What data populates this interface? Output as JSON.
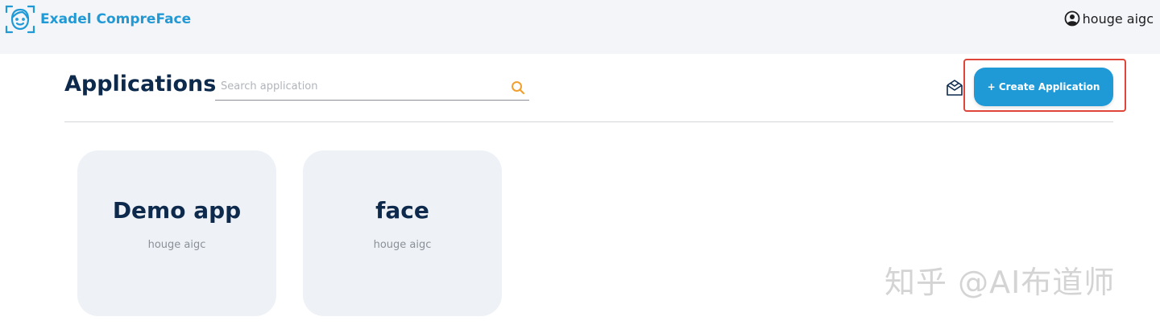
{
  "header": {
    "app_name": "Exadel CompreFace",
    "user_name": "houge aigc"
  },
  "main": {
    "title": "Applications",
    "search": {
      "placeholder": "Search application",
      "value": ""
    },
    "create_button_label": "+ Create Application"
  },
  "applications": [
    {
      "name": "Demo app",
      "owner": "houge aigc"
    },
    {
      "name": "face",
      "owner": "houge aigc"
    }
  ],
  "watermark": "知乎 @AI布道师",
  "icons": {
    "logo": "face-scan-logo-icon",
    "user": "user-circle-icon",
    "search": "search-icon",
    "box": "open-box-icon"
  },
  "colors": {
    "brand": "#1f9ad6",
    "title": "#0d2a4d",
    "search_icon": "#f0a030",
    "highlight": "#e0453a",
    "card_bg": "#eef1f6"
  }
}
